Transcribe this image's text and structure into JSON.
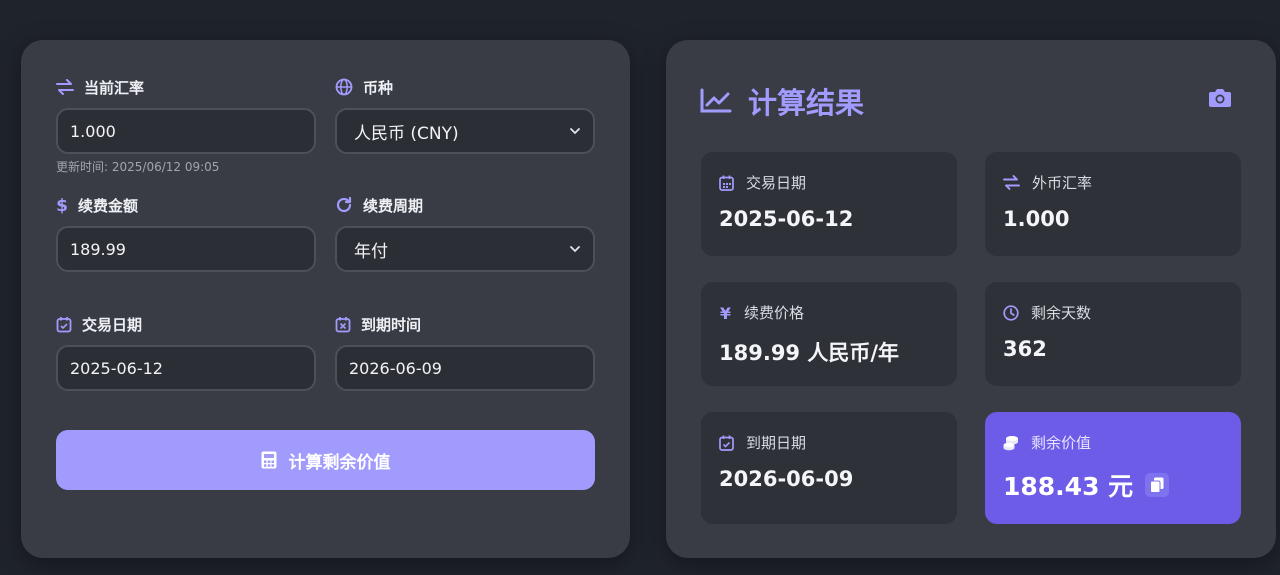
{
  "form": {
    "rate": {
      "label": "当前汇率",
      "value": "1.000",
      "note": "更新时间: 2025/06/12 09:05"
    },
    "currency": {
      "label": "币种",
      "value": "人民币 (CNY)"
    },
    "amount": {
      "label": "续费金额",
      "value": "189.99"
    },
    "period": {
      "label": "续费周期",
      "value": "年付"
    },
    "trade_date": {
      "label": "交易日期",
      "value": "2025-06-12"
    },
    "expiry_date": {
      "label": "到期时间",
      "value": "2026-06-09"
    },
    "calc_button": "计算剩余价值"
  },
  "results": {
    "title": "计算结果",
    "cards": [
      {
        "label": "交易日期",
        "value": "2025-06-12",
        "icon": "calendar-icon"
      },
      {
        "label": "外币汇率",
        "value": "1.000",
        "icon": "exchange-icon"
      },
      {
        "label": "续费价格",
        "value": "189.99 人民币/年",
        "icon": "yen-icon"
      },
      {
        "label": "剩余天数",
        "value": "362",
        "icon": "clock-icon"
      },
      {
        "label": "到期日期",
        "value": "2026-06-09",
        "icon": "calendar-check-icon"
      },
      {
        "label": "剩余价值",
        "value": "188.43 元",
        "icon": "coins-icon"
      }
    ]
  },
  "colors": {
    "accent": "#a29bfe",
    "accent_strong": "#6c5ce7",
    "panel": "#393c44",
    "background": "#1f232b"
  }
}
